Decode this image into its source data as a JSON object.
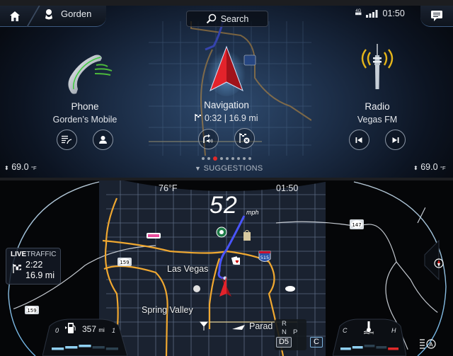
{
  "header": {
    "user_name": "Gorden",
    "search_label": "Search",
    "network": "4G",
    "time": "01:50"
  },
  "tiles": {
    "phone": {
      "title": "Phone",
      "subtitle": "Gorden’s Mobile"
    },
    "navigation": {
      "title": "Navigation",
      "eta": "0:32",
      "separator": "|",
      "distance": "16.9 mi"
    },
    "radio": {
      "title": "Radio",
      "subtitle": "Vegas FM"
    }
  },
  "pager": {
    "count": 9,
    "active_index": 2
  },
  "suggestions_label": "SUGGESTIONS",
  "climate": {
    "left_temp": "69.0",
    "right_temp": "69.0",
    "unit": "°F"
  },
  "cluster": {
    "outside_temp": "76°F",
    "time": "01:50",
    "speed": "52",
    "speed_unit": "mph",
    "live_traffic": {
      "prefix": "LIVE",
      "suffix": "TRAFFIC",
      "time": "2:22",
      "distance": "16.9 mi"
    },
    "map_labels": {
      "city1": "Las Vegas",
      "city2": "Spring Valley",
      "city3": "Parad",
      "route_159a": "159",
      "route_159b": "159",
      "route_147": "147",
      "interstate": "515"
    },
    "fuel": {
      "empty_label": "0",
      "full_label": "1",
      "range": "357",
      "range_unit": "mi",
      "level": 0.6
    },
    "coolant": {
      "cold_label": "C",
      "hot_label": "H",
      "level": 0.45
    },
    "transmission": {
      "gears": [
        "R",
        "N",
        "P"
      ],
      "active_gear": "D5",
      "drive_mode": "C"
    }
  },
  "colors": {
    "accent_red": "#e02a2a",
    "route_blue": "#4a55ff",
    "highway_orange": "#f0a830",
    "gauge_blue": "#8fd0f2"
  }
}
